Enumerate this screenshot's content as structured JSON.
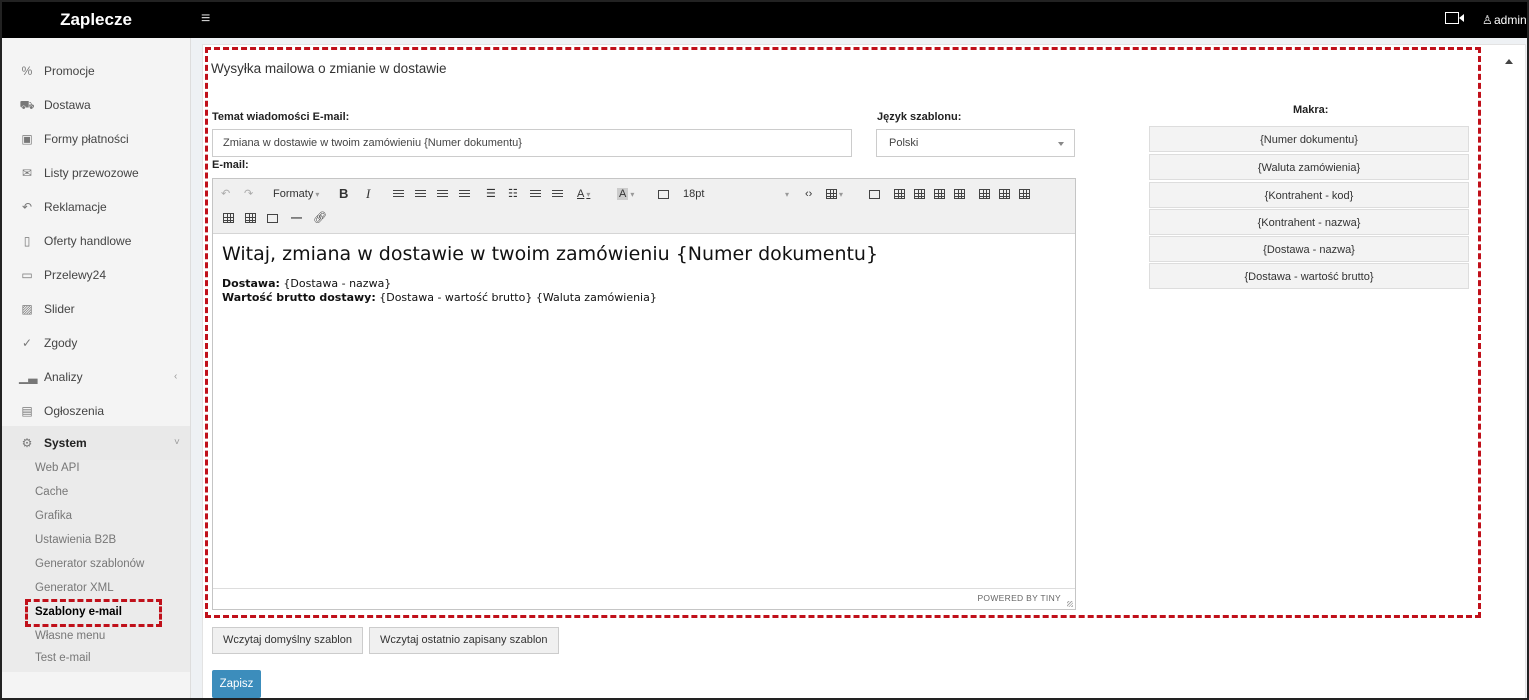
{
  "topbar": {
    "brand": "Zaplecze",
    "menu_icon": "hamburger-icon",
    "user_name": "admin",
    "icons": [
      "video-icon",
      "user-icon"
    ]
  },
  "sidebar": {
    "items": [
      {
        "label": "Promocje",
        "icon": "percent-icon"
      },
      {
        "label": "Dostawa",
        "icon": "truck-icon"
      },
      {
        "label": "Formy płatności",
        "icon": "money-icon"
      },
      {
        "label": "Listy przewozowe",
        "icon": "envelope-icon"
      },
      {
        "label": "Reklamacje",
        "icon": "return-icon"
      },
      {
        "label": "Oferty handlowe",
        "icon": "document-icon"
      },
      {
        "label": "Przelewy24",
        "icon": "card-icon"
      },
      {
        "label": "Slider",
        "icon": "image-icon"
      },
      {
        "label": "Zgody",
        "icon": "check-icon"
      },
      {
        "label": "Analizy",
        "icon": "chart-icon"
      },
      {
        "label": "Ogłoszenia",
        "icon": "newspaper-icon"
      },
      {
        "label": "System",
        "icon": "gears-icon"
      }
    ],
    "system_children": [
      "Web API",
      "Cache",
      "Grafika",
      "Ustawienia B2B",
      "Generator szablonów",
      "Generator XML",
      "Szablony e-mail",
      "Własne menu",
      "Test e-mail"
    ],
    "active_child": "Szablony e-mail"
  },
  "panel": {
    "title": "Wysyłka mailowa o zmianie w dostawie",
    "subject_label": "Temat wiadomości E-mail:",
    "subject_value": "Zmiana w dostawie w twoim zamówieniu {Numer dokumentu}",
    "language_label": "Język szablonu:",
    "language_value": "Polski",
    "email_label": "E-mail:"
  },
  "editor": {
    "toolbar": {
      "formats_label": "Formaty",
      "bold": "B",
      "italic": "I",
      "font_size": "18pt"
    },
    "content": {
      "heading": "Witaj, zmiana w dostawie w twoim zamówieniu {Numer dokumentu}",
      "line1_label": "Dostawa:",
      "line1_value": " {Dostawa - nazwa}",
      "line2_label": "Wartość brutto dostawy:",
      "line2_value": " {Dostawa - wartość brutto} {Waluta zamówienia}"
    },
    "powered_by": "POWERED BY TINY"
  },
  "macros": {
    "title": "Makra:",
    "items": [
      "{Numer dokumentu}",
      "{Waluta zamówienia}",
      "{Kontrahent - kod}",
      "{Kontrahent - nazwa}",
      "{Dostawa - nazwa}",
      "{Dostawa - wartość brutto}"
    ]
  },
  "buttons": {
    "load_default": "Wczytaj domyślny szablon",
    "load_last": "Wczytaj ostatnio zapisany szablon",
    "save": "Zapisz"
  },
  "colors": {
    "topbar": "#000000",
    "primary_button": "#3c8dbc",
    "highlight": "#c0101a"
  }
}
